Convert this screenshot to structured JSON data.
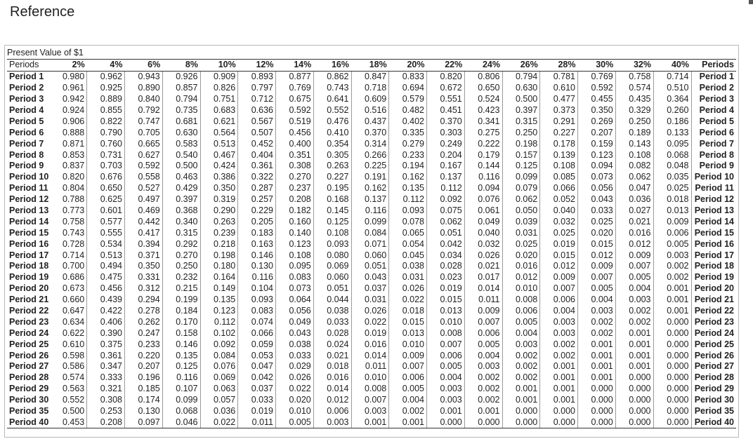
{
  "page": {
    "title": "Reference"
  },
  "table": {
    "caption": "Present Value of $1",
    "header_left": "Periods",
    "header_right": "Periods",
    "rates": [
      "2%",
      "4%",
      "6%",
      "8%",
      "10%",
      "12%",
      "14%",
      "16%",
      "18%",
      "20%",
      "22%",
      "24%",
      "26%",
      "28%",
      "30%",
      "32%",
      "40%"
    ],
    "rows": [
      {
        "period": "Period 1",
        "values": [
          "0.980",
          "0.962",
          "0.943",
          "0.926",
          "0.909",
          "0.893",
          "0.877",
          "0.862",
          "0.847",
          "0.833",
          "0.820",
          "0.806",
          "0.794",
          "0.781",
          "0.769",
          "0.758",
          "0.714"
        ]
      },
      {
        "period": "Period 2",
        "values": [
          "0.961",
          "0.925",
          "0.890",
          "0.857",
          "0.826",
          "0.797",
          "0.769",
          "0.743",
          "0.718",
          "0.694",
          "0.672",
          "0.650",
          "0.630",
          "0.610",
          "0.592",
          "0.574",
          "0.510"
        ]
      },
      {
        "period": "Period 3",
        "values": [
          "0.942",
          "0.889",
          "0.840",
          "0.794",
          "0.751",
          "0.712",
          "0.675",
          "0.641",
          "0.609",
          "0.579",
          "0.551",
          "0.524",
          "0.500",
          "0.477",
          "0.455",
          "0.435",
          "0.364"
        ]
      },
      {
        "period": "Period 4",
        "values": [
          "0.924",
          "0.855",
          "0.792",
          "0.735",
          "0.683",
          "0.636",
          "0.592",
          "0.552",
          "0.516",
          "0.482",
          "0.451",
          "0.423",
          "0.397",
          "0.373",
          "0.350",
          "0.329",
          "0.260"
        ]
      },
      {
        "period": "Period 5",
        "values": [
          "0.906",
          "0.822",
          "0.747",
          "0.681",
          "0.621",
          "0.567",
          "0.519",
          "0.476",
          "0.437",
          "0.402",
          "0.370",
          "0.341",
          "0.315",
          "0.291",
          "0.269",
          "0.250",
          "0.186"
        ]
      },
      {
        "period": "Period 6",
        "values": [
          "0.888",
          "0.790",
          "0.705",
          "0.630",
          "0.564",
          "0.507",
          "0.456",
          "0.410",
          "0.370",
          "0.335",
          "0.303",
          "0.275",
          "0.250",
          "0.227",
          "0.207",
          "0.189",
          "0.133"
        ]
      },
      {
        "period": "Period 7",
        "values": [
          "0.871",
          "0.760",
          "0.665",
          "0.583",
          "0.513",
          "0.452",
          "0.400",
          "0.354",
          "0.314",
          "0.279",
          "0.249",
          "0.222",
          "0.198",
          "0.178",
          "0.159",
          "0.143",
          "0.095"
        ]
      },
      {
        "period": "Period 8",
        "values": [
          "0.853",
          "0.731",
          "0.627",
          "0.540",
          "0.467",
          "0.404",
          "0.351",
          "0.305",
          "0.266",
          "0.233",
          "0.204",
          "0.179",
          "0.157",
          "0.139",
          "0.123",
          "0.108",
          "0.068"
        ]
      },
      {
        "period": "Period 9",
        "values": [
          "0.837",
          "0.703",
          "0.592",
          "0.500",
          "0.424",
          "0.361",
          "0.308",
          "0.263",
          "0.225",
          "0.194",
          "0.167",
          "0.144",
          "0.125",
          "0.108",
          "0.094",
          "0.082",
          "0.048"
        ]
      },
      {
        "period": "Period 10",
        "values": [
          "0.820",
          "0.676",
          "0.558",
          "0.463",
          "0.386",
          "0.322",
          "0.270",
          "0.227",
          "0.191",
          "0.162",
          "0.137",
          "0.116",
          "0.099",
          "0.085",
          "0.073",
          "0.062",
          "0.035"
        ]
      },
      {
        "period": "Period 11",
        "values": [
          "0.804",
          "0.650",
          "0.527",
          "0.429",
          "0.350",
          "0.287",
          "0.237",
          "0.195",
          "0.162",
          "0.135",
          "0.112",
          "0.094",
          "0.079",
          "0.066",
          "0.056",
          "0.047",
          "0.025"
        ]
      },
      {
        "period": "Period 12",
        "values": [
          "0.788",
          "0.625",
          "0.497",
          "0.397",
          "0.319",
          "0.257",
          "0.208",
          "0.168",
          "0.137",
          "0.112",
          "0.092",
          "0.076",
          "0.062",
          "0.052",
          "0.043",
          "0.036",
          "0.018"
        ]
      },
      {
        "period": "Period 13",
        "values": [
          "0.773",
          "0.601",
          "0.469",
          "0.368",
          "0.290",
          "0.229",
          "0.182",
          "0.145",
          "0.116",
          "0.093",
          "0.075",
          "0.061",
          "0.050",
          "0.040",
          "0.033",
          "0.027",
          "0.013"
        ]
      },
      {
        "period": "Period 14",
        "values": [
          "0.758",
          "0.577",
          "0.442",
          "0.340",
          "0.263",
          "0.205",
          "0.160",
          "0.125",
          "0.099",
          "0.078",
          "0.062",
          "0.049",
          "0.039",
          "0.032",
          "0.025",
          "0.021",
          "0.009"
        ]
      },
      {
        "period": "Period 15",
        "values": [
          "0.743",
          "0.555",
          "0.417",
          "0.315",
          "0.239",
          "0.183",
          "0.140",
          "0.108",
          "0.084",
          "0.065",
          "0.051",
          "0.040",
          "0.031",
          "0.025",
          "0.020",
          "0.016",
          "0.006"
        ]
      },
      {
        "period": "Period 16",
        "values": [
          "0.728",
          "0.534",
          "0.394",
          "0.292",
          "0.218",
          "0.163",
          "0.123",
          "0.093",
          "0.071",
          "0.054",
          "0.042",
          "0.032",
          "0.025",
          "0.019",
          "0.015",
          "0.012",
          "0.005"
        ]
      },
      {
        "period": "Period 17",
        "values": [
          "0.714",
          "0.513",
          "0.371",
          "0.270",
          "0.198",
          "0.146",
          "0.108",
          "0.080",
          "0.060",
          "0.045",
          "0.034",
          "0.026",
          "0.020",
          "0.015",
          "0.012",
          "0.009",
          "0.003"
        ]
      },
      {
        "period": "Period 18",
        "values": [
          "0.700",
          "0.494",
          "0.350",
          "0.250",
          "0.180",
          "0.130",
          "0.095",
          "0.069",
          "0.051",
          "0.038",
          "0.028",
          "0.021",
          "0.016",
          "0.012",
          "0.009",
          "0.007",
          "0.002"
        ]
      },
      {
        "period": "Period 19",
        "values": [
          "0.686",
          "0.475",
          "0.331",
          "0.232",
          "0.164",
          "0.116",
          "0.083",
          "0.060",
          "0.043",
          "0.031",
          "0.023",
          "0.017",
          "0.012",
          "0.009",
          "0.007",
          "0.005",
          "0.002"
        ]
      },
      {
        "period": "Period 20",
        "values": [
          "0.673",
          "0.456",
          "0.312",
          "0.215",
          "0.149",
          "0.104",
          "0.073",
          "0.051",
          "0.037",
          "0.026",
          "0.019",
          "0.014",
          "0.010",
          "0.007",
          "0.005",
          "0.004",
          "0.001"
        ]
      },
      {
        "period": "Period 21",
        "values": [
          "0.660",
          "0.439",
          "0.294",
          "0.199",
          "0.135",
          "0.093",
          "0.064",
          "0.044",
          "0.031",
          "0.022",
          "0.015",
          "0.011",
          "0.008",
          "0.006",
          "0.004",
          "0.003",
          "0.001"
        ]
      },
      {
        "period": "Period 22",
        "values": [
          "0.647",
          "0.422",
          "0.278",
          "0.184",
          "0.123",
          "0.083",
          "0.056",
          "0.038",
          "0.026",
          "0.018",
          "0.013",
          "0.009",
          "0.006",
          "0.004",
          "0.003",
          "0.002",
          "0.001"
        ]
      },
      {
        "period": "Period 23",
        "values": [
          "0.634",
          "0.406",
          "0.262",
          "0.170",
          "0.112",
          "0.074",
          "0.049",
          "0.033",
          "0.022",
          "0.015",
          "0.010",
          "0.007",
          "0.005",
          "0.003",
          "0.002",
          "0.002",
          "0.000"
        ]
      },
      {
        "period": "Period 24",
        "values": [
          "0.622",
          "0.390",
          "0.247",
          "0.158",
          "0.102",
          "0.066",
          "0.043",
          "0.028",
          "0.019",
          "0.013",
          "0.008",
          "0.006",
          "0.004",
          "0.003",
          "0.002",
          "0.001",
          "0.000"
        ]
      },
      {
        "period": "Period 25",
        "values": [
          "0.610",
          "0.375",
          "0.233",
          "0.146",
          "0.092",
          "0.059",
          "0.038",
          "0.024",
          "0.016",
          "0.010",
          "0.007",
          "0.005",
          "0.003",
          "0.002",
          "0.001",
          "0.001",
          "0.000"
        ]
      },
      {
        "period": "Period 26",
        "values": [
          "0.598",
          "0.361",
          "0.220",
          "0.135",
          "0.084",
          "0.053",
          "0.033",
          "0.021",
          "0.014",
          "0.009",
          "0.006",
          "0.004",
          "0.002",
          "0.002",
          "0.001",
          "0.001",
          "0.000"
        ]
      },
      {
        "period": "Period 27",
        "values": [
          "0.586",
          "0.347",
          "0.207",
          "0.125",
          "0.076",
          "0.047",
          "0.029",
          "0.018",
          "0.011",
          "0.007",
          "0.005",
          "0.003",
          "0.002",
          "0.001",
          "0.001",
          "0.001",
          "0.000"
        ]
      },
      {
        "period": "Period 28",
        "values": [
          "0.574",
          "0.333",
          "0.196",
          "0.116",
          "0.069",
          "0.042",
          "0.026",
          "0.016",
          "0.010",
          "0.006",
          "0.004",
          "0.002",
          "0.002",
          "0.001",
          "0.001",
          "0.000",
          "0.000"
        ]
      },
      {
        "period": "Period 29",
        "values": [
          "0.563",
          "0.321",
          "0.185",
          "0.107",
          "0.063",
          "0.037",
          "0.022",
          "0.014",
          "0.008",
          "0.005",
          "0.003",
          "0.002",
          "0.001",
          "0.001",
          "0.000",
          "0.000",
          "0.000"
        ]
      },
      {
        "period": "Period 30",
        "values": [
          "0.552",
          "0.308",
          "0.174",
          "0.099",
          "0.057",
          "0.033",
          "0.020",
          "0.012",
          "0.007",
          "0.004",
          "0.003",
          "0.002",
          "0.001",
          "0.001",
          "0.000",
          "0.000",
          "0.000"
        ]
      },
      {
        "period": "Period 35",
        "values": [
          "0.500",
          "0.253",
          "0.130",
          "0.068",
          "0.036",
          "0.019",
          "0.010",
          "0.006",
          "0.003",
          "0.002",
          "0.001",
          "0.001",
          "0.000",
          "0.000",
          "0.000",
          "0.000",
          "0.000"
        ]
      },
      {
        "period": "Period 40",
        "values": [
          "0.453",
          "0.208",
          "0.097",
          "0.046",
          "0.022",
          "0.011",
          "0.005",
          "0.003",
          "0.001",
          "0.001",
          "0.000",
          "0.000",
          "0.000",
          "0.000",
          "0.000",
          "0.000",
          "0.000"
        ]
      }
    ]
  }
}
